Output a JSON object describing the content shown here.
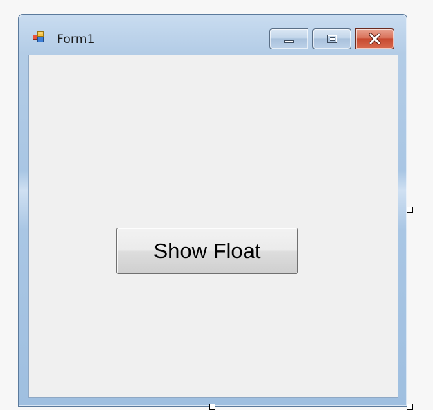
{
  "window": {
    "title": "Form1"
  },
  "titlebar": {
    "icons": {
      "app": "form-app-icon",
      "minimize": "minimize-icon",
      "maximize": "maximize-icon",
      "close": "close-icon"
    }
  },
  "form": {
    "button_label": "Show Float"
  },
  "colors": {
    "frame": "#a9c6e4",
    "client_background": "#f0f0f0",
    "close_button": "#c74a30",
    "page_background": "#f7f7f7"
  }
}
